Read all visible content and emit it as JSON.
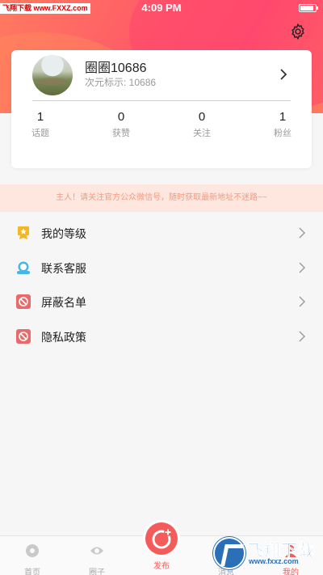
{
  "status_bar": {
    "watermark": "飞翔下载 www.FXXZ.com",
    "time": "4:09 PM",
    "battery_level": 0.9
  },
  "profile": {
    "username": "圈圈10686",
    "subtitle": "次元标示: 10686",
    "stats": [
      {
        "value": "1",
        "label": "话题"
      },
      {
        "value": "0",
        "label": "获赞"
      },
      {
        "value": "0",
        "label": "关注"
      },
      {
        "value": "1",
        "label": "粉丝"
      }
    ]
  },
  "notice": "主人！请关注官方公众微信号，随时获取最新地址不迷路~~",
  "menu": [
    {
      "label": "我的等级",
      "icon": "level-badge-icon",
      "color": "#f3b626"
    },
    {
      "label": "联系客服",
      "icon": "customer-service-icon",
      "color": "#45b6e6"
    },
    {
      "label": "屏蔽名单",
      "icon": "block-icon",
      "color": "#e96a6a"
    },
    {
      "label": "隐私政策",
      "icon": "block-icon",
      "color": "#e96a6a"
    }
  ],
  "tabbar": {
    "tabs": [
      {
        "label": "首页",
        "icon": "home-icon"
      },
      {
        "label": "圈子",
        "icon": "circle-icon"
      },
      {
        "label": "消息",
        "icon": "message-icon"
      },
      {
        "label": "我的",
        "icon": "profile-icon"
      }
    ],
    "publish_label": "发布"
  },
  "watermark_bottom": {
    "title": "飞翔下载",
    "url": "www.fxxz.com"
  },
  "colors": {
    "accent": "#f45b5b",
    "notice_bg": "#fde7df",
    "notice_text": "#f39a7f"
  }
}
